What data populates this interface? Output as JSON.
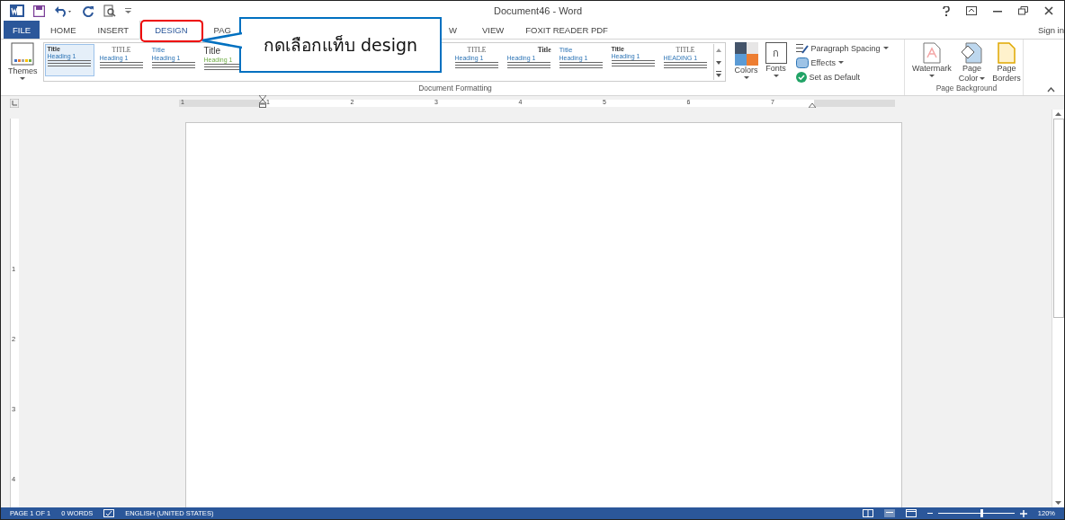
{
  "window": {
    "title": "Document46 - Word",
    "sign_in": "Sign in"
  },
  "tabs": [
    {
      "label": "FILE",
      "kind": "file",
      "selected": false
    },
    {
      "label": "HOME",
      "kind": "tab",
      "selected": false
    },
    {
      "label": "INSERT",
      "kind": "tab",
      "selected": false
    },
    {
      "label": "DESIGN",
      "kind": "tab",
      "selected": true
    },
    {
      "label": "PAG",
      "kind": "tab",
      "selected": false
    },
    {
      "label": "W",
      "kind": "gap",
      "selected": false
    },
    {
      "label": "VIEW",
      "kind": "tab",
      "selected": false
    },
    {
      "label": "FOXIT READER PDF",
      "kind": "tab",
      "selected": false
    }
  ],
  "callout": {
    "text": "กดเลือกแท็บ design"
  },
  "ribbon": {
    "themes": "Themes",
    "styles_before": [
      {
        "title": "Title",
        "heading": "Heading 1",
        "kind": "plain",
        "selected": true
      },
      {
        "title": "TITLE",
        "heading": "Heading 1",
        "kind": "caps",
        "selected": false
      },
      {
        "title": "Title",
        "heading": "Heading 1",
        "kind": "blue",
        "selected": false
      },
      {
        "title": "Title",
        "heading": "Heading 1",
        "kind": "green",
        "selected": false
      }
    ],
    "styles_after": [
      {
        "title": "TITLE",
        "heading": "Heading 1",
        "kind": "caps",
        "selected": false
      },
      {
        "title": "Title",
        "heading": "Heading 1",
        "kind": "right",
        "selected": false
      },
      {
        "title": "Title",
        "heading": "Heading 1",
        "kind": "blue",
        "selected": false
      },
      {
        "title": "Title",
        "heading": "Heading 1",
        "kind": "plain",
        "selected": false
      },
      {
        "title": "TITLE",
        "heading": "HEADING 1",
        "kind": "caps",
        "selected": false
      }
    ],
    "colors": "Colors",
    "fonts": "Fonts",
    "fonts_glyph": "ก",
    "paragraph_spacing": "Paragraph Spacing",
    "effects": "Effects",
    "set_default": "Set as Default",
    "group_formatting": "Document Formatting",
    "watermark": "Watermark",
    "page_color": [
      "Page",
      "Color"
    ],
    "page_borders": [
      "Page",
      "Borders"
    ],
    "group_background": "Page Background"
  },
  "ruler": {
    "numbers": [
      "1",
      "1",
      "2",
      "3",
      "4",
      "5",
      "6",
      "7"
    ],
    "vertical_numbers": [
      "1",
      "2",
      "3",
      "4"
    ]
  },
  "status_bar": {
    "page": "PAGE 1 OF 1",
    "words": "0 WORDS",
    "language": "ENGLISH (UNITED STATES)",
    "zoom": "120%",
    "level": 0.55
  }
}
